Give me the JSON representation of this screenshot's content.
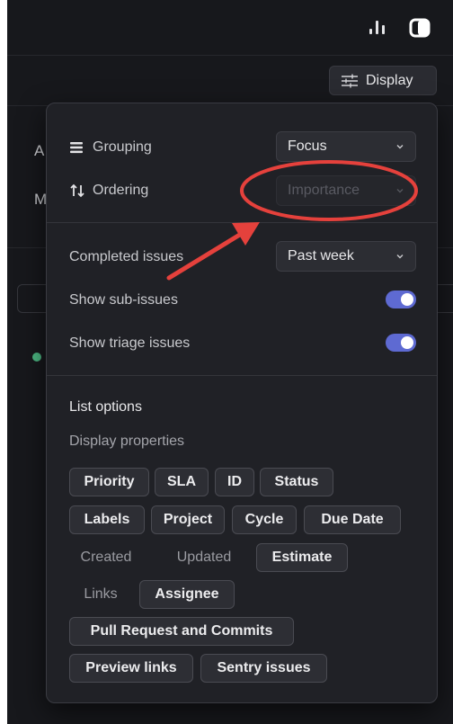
{
  "topbar": {
    "chart_icon": "bar-chart-icon",
    "panel_icon": "sidebar-panel-icon"
  },
  "toolbar": {
    "display_label": "Display",
    "display_icon": "sliders-icon"
  },
  "background": {
    "peek_letter_1": "A",
    "peek_letter_2": "M"
  },
  "panel": {
    "grouping": {
      "label": "Grouping",
      "icon": "list-icon",
      "value": "Focus"
    },
    "ordering": {
      "label": "Ordering",
      "icon": "sort-arrows-icon",
      "value": "Importance",
      "disabled": true
    },
    "completed": {
      "label": "Completed issues",
      "value": "Past week"
    },
    "sub_issues": {
      "label": "Show sub-issues",
      "on": true
    },
    "triage": {
      "label": "Show triage issues",
      "on": true
    },
    "list_options": {
      "title": "List options",
      "subtitle": "Display properties",
      "chips": [
        {
          "label": "Priority",
          "active": true
        },
        {
          "label": "SLA",
          "active": true
        },
        {
          "label": "ID",
          "active": true
        },
        {
          "label": "Status",
          "active": true
        },
        {
          "label": "Labels",
          "active": true
        },
        {
          "label": "Project",
          "active": true
        },
        {
          "label": "Cycle",
          "active": true
        },
        {
          "label": "Due Date",
          "active": true
        },
        {
          "label": "Created",
          "active": false
        },
        {
          "label": "Updated",
          "active": false
        },
        {
          "label": "Estimate",
          "active": true
        },
        {
          "label": "Links",
          "active": false
        },
        {
          "label": "Assignee",
          "active": true
        },
        {
          "label": "Pull Request and Commits",
          "active": true
        },
        {
          "label": "Preview links",
          "active": true
        },
        {
          "label": "Sentry issues",
          "active": true
        }
      ]
    }
  },
  "colors": {
    "accent": "#5e6ad2",
    "annotation": "#e5413c",
    "status_green": "#4cb782"
  }
}
